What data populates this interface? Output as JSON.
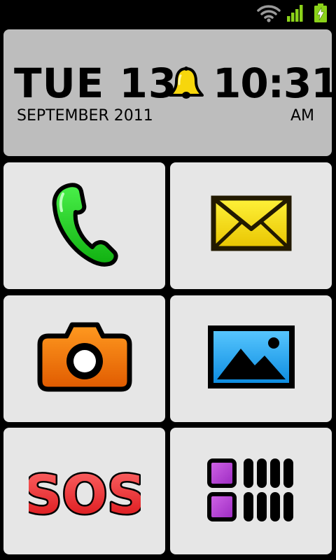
{
  "clock": {
    "day": "TUE 13",
    "month_year": "SEPTEMBER 2011",
    "time": "10:31",
    "ampm": "AM"
  },
  "icons": {
    "status": [
      "wifi-icon",
      "signal-icon",
      "battery-charging-icon"
    ],
    "alarm": "bell-icon",
    "tiles": [
      "phone-icon",
      "envelope-icon",
      "camera-icon",
      "gallery-icon",
      "sos-icon",
      "apps-grid-icon"
    ]
  },
  "tiles": {
    "sos_label": "SOS"
  },
  "colors": {
    "phone": "#1fd21f",
    "mail": "#f4dc0c",
    "camera": "#f07a10",
    "gallery": "#1aa6f0",
    "sos": "#e8262a",
    "apps": "#b13ad0",
    "clock_bg": "#bdbdbd",
    "tile_bg": "#e6e6e6"
  }
}
